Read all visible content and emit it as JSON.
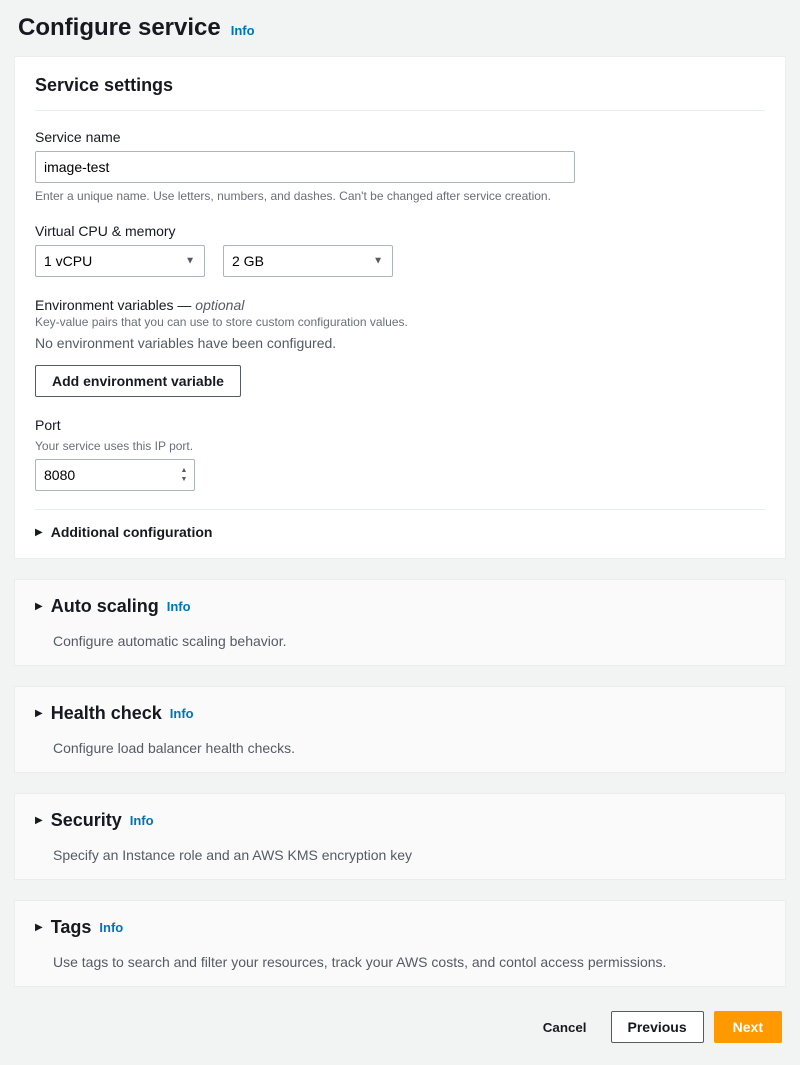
{
  "page": {
    "title": "Configure service",
    "info": "Info"
  },
  "serviceSettings": {
    "title": "Service settings",
    "serviceName": {
      "label": "Service name",
      "value": "image-test",
      "help": "Enter a unique name. Use letters, numbers, and dashes. Can't be changed after service creation."
    },
    "vcpuMemory": {
      "label": "Virtual CPU & memory",
      "vcpu": "1 vCPU",
      "memory": "2 GB"
    },
    "envVars": {
      "heading": "Environment variables — ",
      "optional": "optional",
      "help": "Key-value pairs that you can use to store custom configuration values.",
      "empty": "No environment variables have been configured.",
      "addButton": "Add environment variable"
    },
    "port": {
      "label": "Port",
      "help": "Your service uses this IP port.",
      "value": "8080"
    },
    "additionalConfig": "Additional configuration"
  },
  "sections": {
    "autoScaling": {
      "title": "Auto scaling",
      "info": "Info",
      "desc": "Configure automatic scaling behavior."
    },
    "healthCheck": {
      "title": "Health check",
      "info": "Info",
      "desc": "Configure load balancer health checks."
    },
    "security": {
      "title": "Security",
      "info": "Info",
      "desc": "Specify an Instance role and an AWS KMS encryption key"
    },
    "tags": {
      "title": "Tags",
      "info": "Info",
      "desc": "Use tags to search and filter your resources, track your AWS costs, and contol access permissions."
    }
  },
  "footer": {
    "cancel": "Cancel",
    "previous": "Previous",
    "next": "Next"
  }
}
